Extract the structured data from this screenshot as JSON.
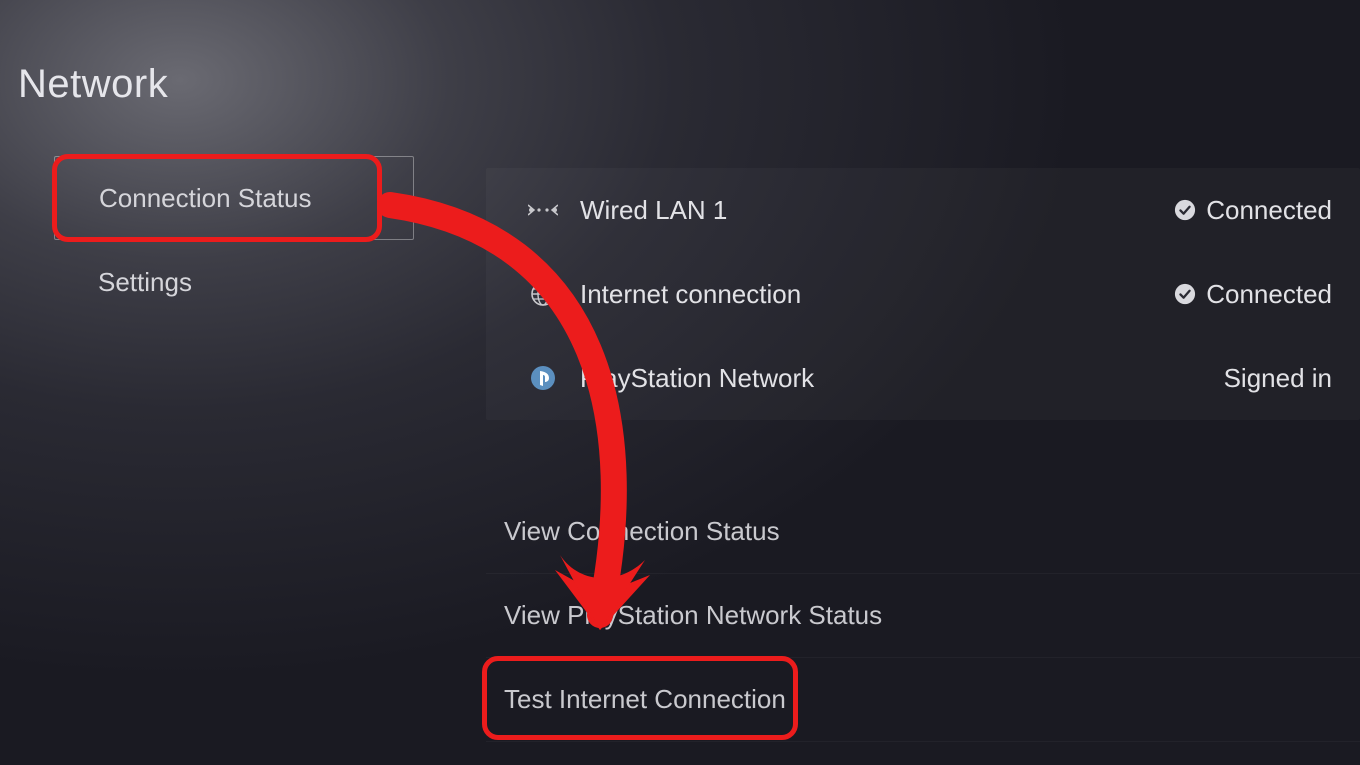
{
  "pageTitle": "Network",
  "sidebar": [
    {
      "label": "Connection Status",
      "selected": true
    },
    {
      "label": "Settings",
      "selected": false
    }
  ],
  "statusRows": [
    {
      "icon": "wired",
      "label": "Wired LAN 1",
      "status": "Connected",
      "statusIcon": "check"
    },
    {
      "icon": "globe",
      "label": "Internet connection",
      "status": "Connected",
      "statusIcon": "check"
    },
    {
      "icon": "psn",
      "label": "PlayStation Network",
      "status": "Signed in",
      "statusIcon": "none"
    }
  ],
  "actions": [
    {
      "label": "View Connection Status"
    },
    {
      "label": "View PlayStation Network Status"
    },
    {
      "label": "Test Internet Connection"
    }
  ],
  "annotations": {
    "highlightSidebarIndex": 0,
    "highlightActionIndex": 2,
    "arrowColor": "#ec1c1c"
  }
}
